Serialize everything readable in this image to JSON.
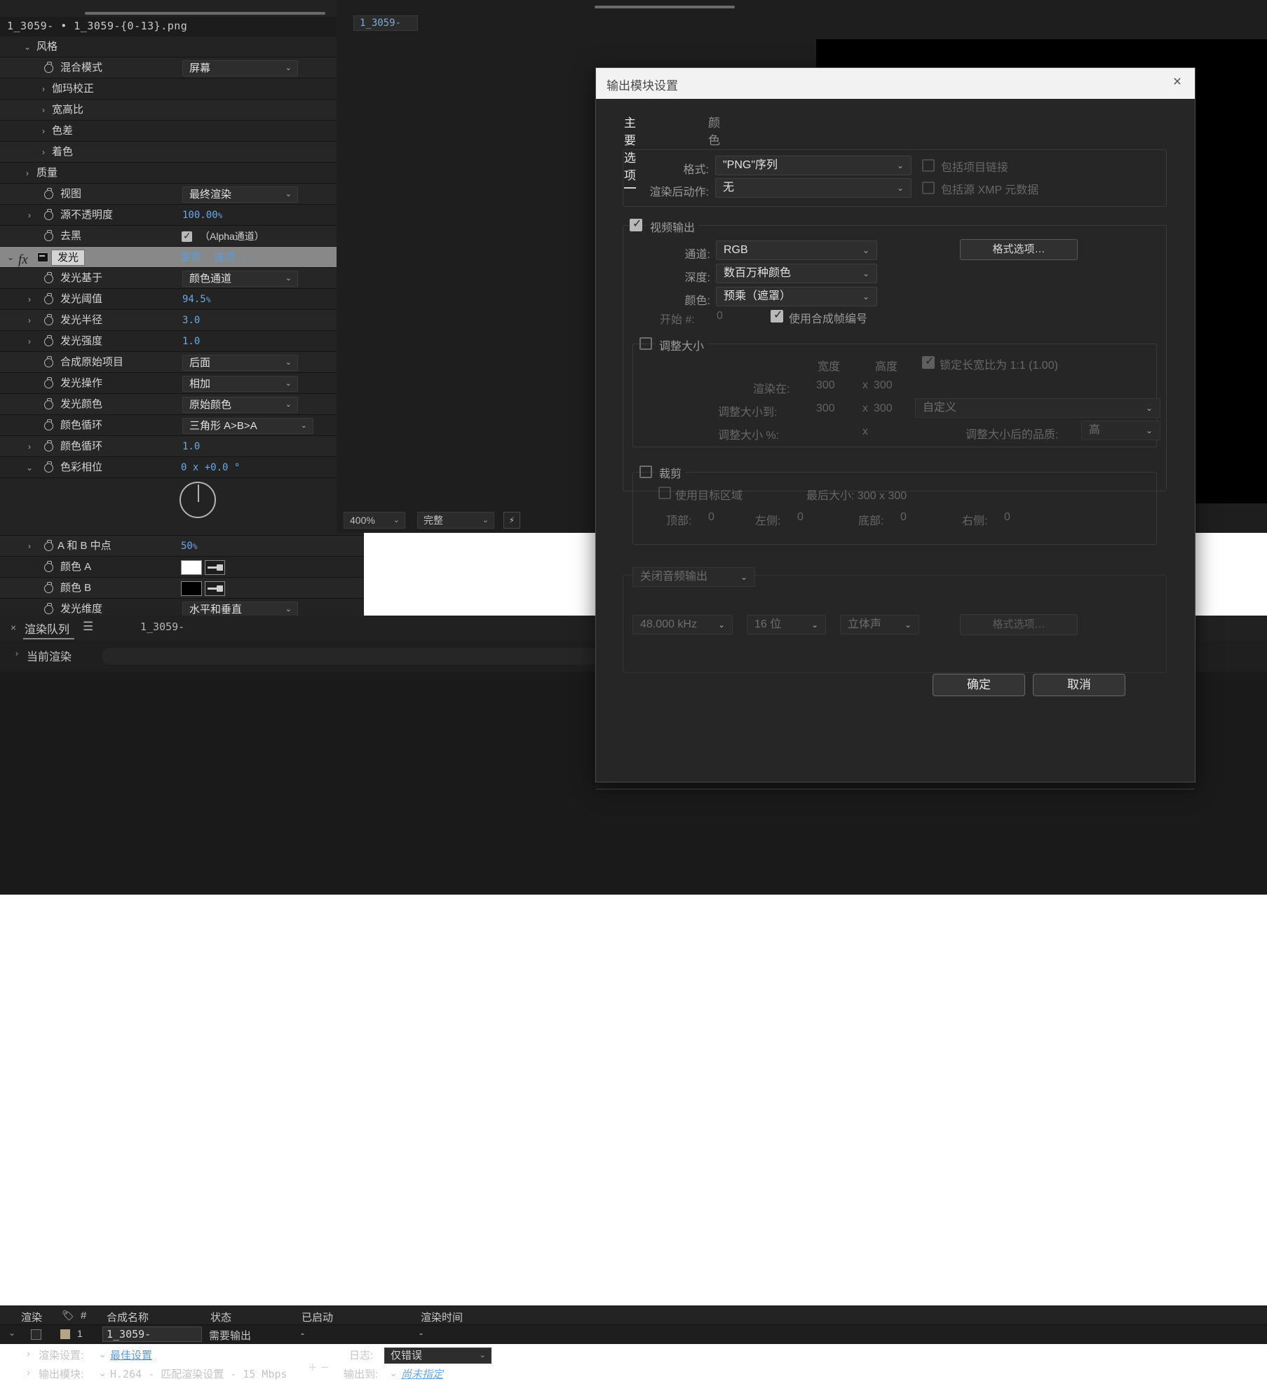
{
  "fx_panel": {
    "file_path": "1_3059- • 1_3059-{0-13}.png",
    "rows": [
      {
        "label": "风格",
        "kind": "group"
      },
      {
        "label": "混合模式",
        "kind": "dropdown",
        "value": "屏幕"
      },
      {
        "label": "伽玛校正",
        "kind": "group2"
      },
      {
        "label": "宽高比",
        "kind": "group2"
      },
      {
        "label": "色差",
        "kind": "group2"
      },
      {
        "label": "着色",
        "kind": "group2"
      },
      {
        "label": "质量",
        "kind": "group"
      },
      {
        "label": "视图",
        "kind": "dropdown",
        "value": "最终渲染"
      },
      {
        "label": "源不透明度",
        "kind": "number",
        "value": "100.00",
        "unit": "%"
      },
      {
        "label": "去黑",
        "kind": "checkbox",
        "value": "（Alpha通道）"
      },
      {
        "label": "发光",
        "kind": "effect",
        "reset": "重置",
        "options": "选项..."
      },
      {
        "label": "发光基于",
        "kind": "dropdown",
        "value": "颜色通道"
      },
      {
        "label": "发光阈值",
        "kind": "number",
        "value": "94.5",
        "unit": "%"
      },
      {
        "label": "发光半径",
        "kind": "number",
        "value": "3.0",
        "unit": ""
      },
      {
        "label": "发光强度",
        "kind": "number",
        "value": "1.0",
        "unit": ""
      },
      {
        "label": "合成原始项目",
        "kind": "dropdown",
        "value": "后面"
      },
      {
        "label": "发光操作",
        "kind": "dropdown",
        "value": "相加"
      },
      {
        "label": "发光颜色",
        "kind": "dropdown",
        "value": "原始颜色"
      },
      {
        "label": "颜色循环",
        "kind": "dropdown",
        "value": "三角形 A>B>A"
      },
      {
        "label": "颜色循环",
        "kind": "number",
        "value": "1.0",
        "unit": ""
      },
      {
        "label": "色彩相位",
        "kind": "dial",
        "value": "0 x +0.0 °"
      },
      {
        "label": "A 和 B 中点",
        "kind": "number",
        "value": "50",
        "unit": "%"
      },
      {
        "label": "颜色 A",
        "kind": "color",
        "color": "#ffffff"
      },
      {
        "label": "颜色 B",
        "kind": "color",
        "color": "#000000"
      },
      {
        "label": "发光维度",
        "kind": "dropdown",
        "value": "水平和垂直"
      }
    ]
  },
  "viewer": {
    "tab_label": "1_3059-",
    "zoom": "400%",
    "resolution": "完整"
  },
  "render_queue": {
    "tab_label": "渲染队列",
    "tab2_label": "1_3059-",
    "current_render_label": "当前渲染",
    "elapsed": "-:--:--",
    "columns": [
      "渲染",
      "#",
      "合成名称",
      "状态",
      "已启动",
      "渲染时间"
    ],
    "row": {
      "index": "1",
      "comp_name": "1_3059-",
      "status": "需要输出",
      "started": "-",
      "render_time": "-"
    },
    "render_settings_label": "渲染设置:",
    "render_settings_value": "最佳设置",
    "log_label": "日志:",
    "log_value": "仅错误",
    "output_module_label": "输出模块:",
    "output_module_value": "H.264 - 匹配渲染设置 - 15 Mbps",
    "output_to_label": "输出到:",
    "output_to_value": "尚未指定"
  },
  "dialog": {
    "title": "输出模块设置",
    "close_icon": "×",
    "tabs": [
      {
        "label": "主要选项",
        "active": true
      },
      {
        "label": "颜色",
        "active": false
      }
    ],
    "format_label": "格式:",
    "format_value": "\"PNG\"序列",
    "post_render_label": "渲染后动作:",
    "post_render_value": "无",
    "include_project_link_label": "包括项目链接",
    "include_xmp_label": "包括源 XMP 元数据",
    "video_output_label": "视频输出",
    "channels_label": "通道:",
    "channels_value": "RGB",
    "depth_label": "深度:",
    "depth_value": "数百万种颜色",
    "color_label": "颜色:",
    "color_value": "预乘（遮罩）",
    "format_options_button": "格式选项…",
    "start_num_label": "开始 #:",
    "start_num_value": "0",
    "use_comp_frame_label": "使用合成帧编号",
    "resize_label": "调整大小",
    "width_label": "宽度",
    "height_label": "高度",
    "lock_aspect_label": "锁定长宽比为 1:1 (1.00)",
    "render_at_label": "渲染在:",
    "render_at_w": "300",
    "render_at_x": "x",
    "render_at_h": "300",
    "resize_to_label": "调整大小到:",
    "resize_to_w": "300",
    "resize_to_h": "300",
    "resize_preset": "自定义",
    "resize_pct_label": "调整大小 %:",
    "resize_quality_label": "调整大小后的品质:",
    "resize_quality_value": "高",
    "crop_label": "裁剪",
    "use_roi_label": "使用目标区域",
    "final_size_label": "最后大小: 300 x 300",
    "top_label": "顶部:",
    "top_value": "0",
    "left_label": "左侧:",
    "left_value": "0",
    "bottom_label": "底部:",
    "bottom_value": "0",
    "right_label": "右侧:",
    "right_value": "0",
    "audio_output_value": "关闭音频输出",
    "sample_rate": "48.000 kHz",
    "bit_depth": "16 位",
    "channel_mode": "立体声",
    "audio_format_options": "格式选项…",
    "ok_button": "确定",
    "cancel_button": "取消"
  }
}
